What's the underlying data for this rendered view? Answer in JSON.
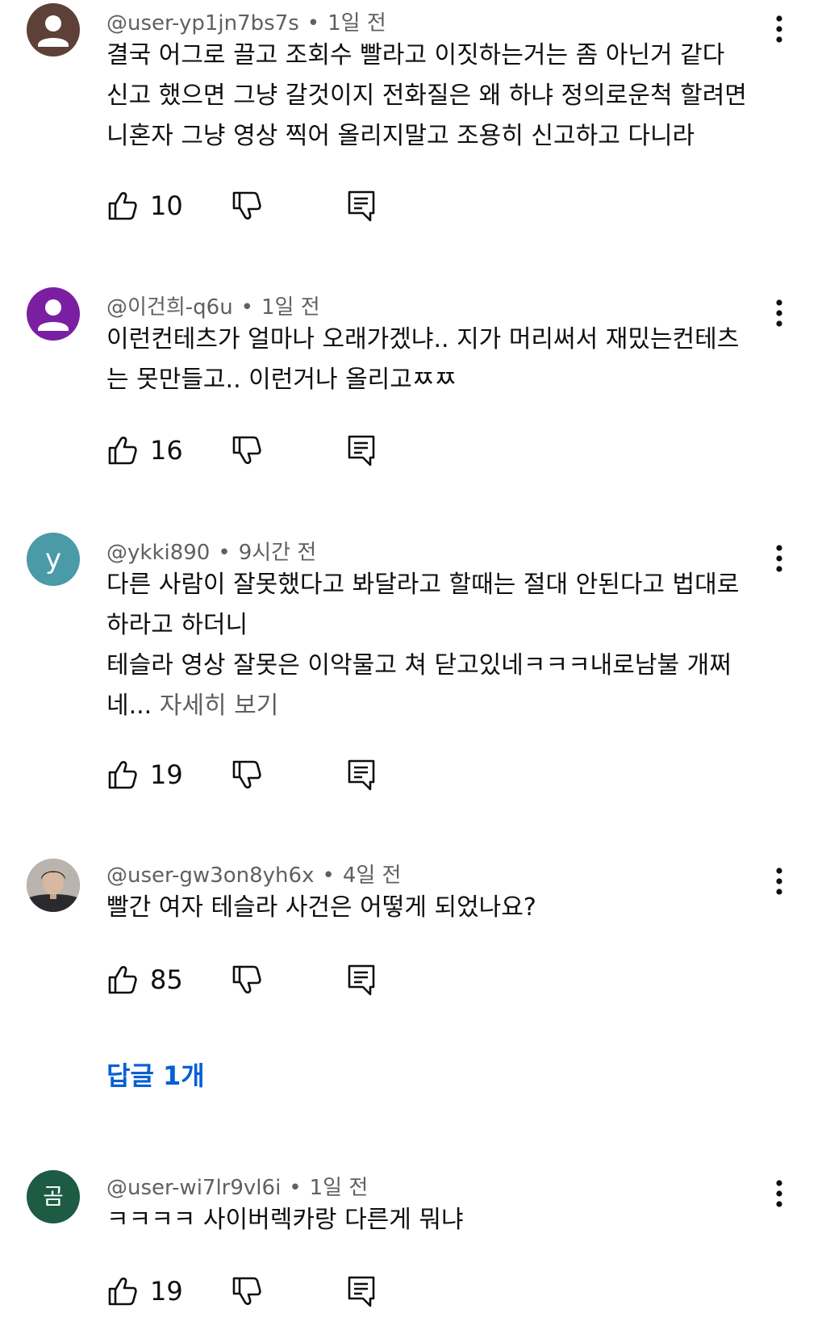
{
  "comments": [
    {
      "author": "@user-yp1jn7bs7s",
      "time": "1일 전",
      "avatar": {
        "type": "person-silhouette",
        "color": "#5d4037"
      },
      "lines": [
        "결국 어그로 끌고 조회수 빨라고 이짓하는거는 좀 아닌거 같다",
        "신고 했으면 그냥 갈것이지 전화질은 왜 하냐 정의로운척 할려면",
        "니혼자 그냥 영상 찍어 올리지말고 조용히 신고하고 다니라"
      ],
      "likes": "10"
    },
    {
      "author": "@이건희-q6u",
      "time": "1일 전",
      "avatar": {
        "type": "person-silhouette",
        "color": "#7b1fa2"
      },
      "lines": [
        "이런컨테츠가 얼마나 오래가겠냐.. 지가 머리써서 재밌는컨테츠",
        "는 못만들고.. 이런거나 올리고ㅉㅉ"
      ],
      "likes": "16"
    },
    {
      "author": "@ykki890",
      "time": "9시간 전",
      "avatar": {
        "type": "letter",
        "letter": "y",
        "color": "#4a9aa8"
      },
      "lines": [
        "다른 사람이 잘못했다고 봐달라고 할때는 절대 안된다고 법대로",
        "하라고 하더니",
        "테슬라 영상 잘못은 이악물고 쳐 닫고있네ㅋㅋㅋ내로남불 개쩌",
        "네..."
      ],
      "read_more": "자세히 보기",
      "likes": "19"
    },
    {
      "author": "@user-gw3on8yh6x",
      "time": "4일 전",
      "avatar": {
        "type": "photo",
        "color": "#6d6a68"
      },
      "lines": [
        "빨간 여자 테슬라 사건은 어떻게 되었나요?"
      ],
      "likes": "85",
      "replies_label": "답글 1개"
    },
    {
      "author": "@user-wi7lr9vl6i",
      "time": "1일 전",
      "avatar": {
        "type": "letter",
        "letter": "곰",
        "color": "#1d5b45"
      },
      "lines": [
        "ㅋㅋㅋㅋ 사이버렉카랑 다른게 뭐냐"
      ],
      "likes": "19"
    }
  ],
  "meta_separator": "•",
  "icons": {
    "like": "thumbs-up-icon",
    "dislike": "thumbs-down-icon",
    "reply": "reply-comment-icon",
    "menu": "more-vert-icon"
  },
  "colors": {
    "text": "#0f0f0f",
    "secondary": "#606060",
    "link": "#065fd4"
  }
}
